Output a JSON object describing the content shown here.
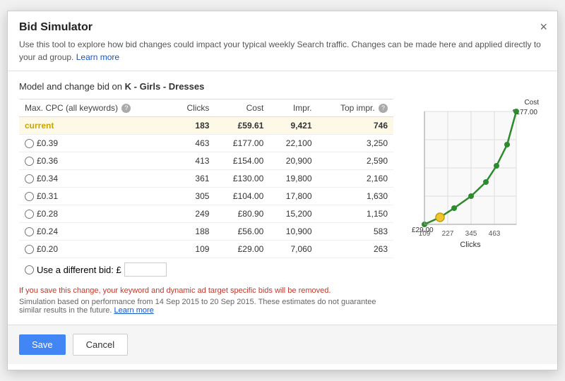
{
  "dialog": {
    "title": "Bid Simulator",
    "close_label": "×",
    "description": "Use this tool to explore how bid changes could impact your typical weekly Search traffic. Changes can be made here and applied directly to your ad group.",
    "learn_more": "Learn more",
    "model_label": "Model and change bid on",
    "ad_group": "K - Girls - Dresses",
    "table": {
      "headers": [
        "Max. CPC (all keywords)",
        "Clicks",
        "Cost",
        "Impr.",
        "Top impr."
      ],
      "rows": [
        {
          "label": "current",
          "is_current": true,
          "clicks": "183",
          "cost": "£59.61",
          "impr": "9,421",
          "top_impr": "746"
        },
        {
          "label": "£0.39",
          "is_current": false,
          "clicks": "463",
          "cost": "£177.00",
          "impr": "22,100",
          "top_impr": "3,250"
        },
        {
          "label": "£0.36",
          "is_current": false,
          "clicks": "413",
          "cost": "£154.00",
          "impr": "20,900",
          "top_impr": "2,590"
        },
        {
          "label": "£0.34",
          "is_current": false,
          "clicks": "361",
          "cost": "£130.00",
          "impr": "19,800",
          "top_impr": "2,160"
        },
        {
          "label": "£0.31",
          "is_current": false,
          "clicks": "305",
          "cost": "£104.00",
          "impr": "17,800",
          "top_impr": "1,630"
        },
        {
          "label": "£0.28",
          "is_current": false,
          "clicks": "249",
          "cost": "£80.90",
          "impr": "15,200",
          "top_impr": "1,150"
        },
        {
          "label": "£0.24",
          "is_current": false,
          "clicks": "188",
          "cost": "£56.00",
          "impr": "10,900",
          "top_impr": "583"
        },
        {
          "label": "£0.20",
          "is_current": false,
          "clicks": "109",
          "cost": "£29.00",
          "impr": "7,060",
          "top_impr": "263"
        }
      ],
      "custom_bid_label": "Use a different bid: £"
    },
    "warning": "If you save this change, your keyword and dynamic ad target specific bids will be removed.",
    "simulation_note": "Simulation based on performance from 14 Sep 2015 to 20 Sep 2015. These estimates do not guarantee similar results in the future.",
    "simulation_learn_more": "Learn more",
    "chart": {
      "y_axis_label": "Cost",
      "y_max": "£177.00",
      "y_min": "£29.00",
      "x_axis_label": "Clicks",
      "x_labels": [
        "109",
        "227",
        "345",
        "463"
      ]
    },
    "footer": {
      "save_label": "Save",
      "cancel_label": "Cancel"
    }
  }
}
